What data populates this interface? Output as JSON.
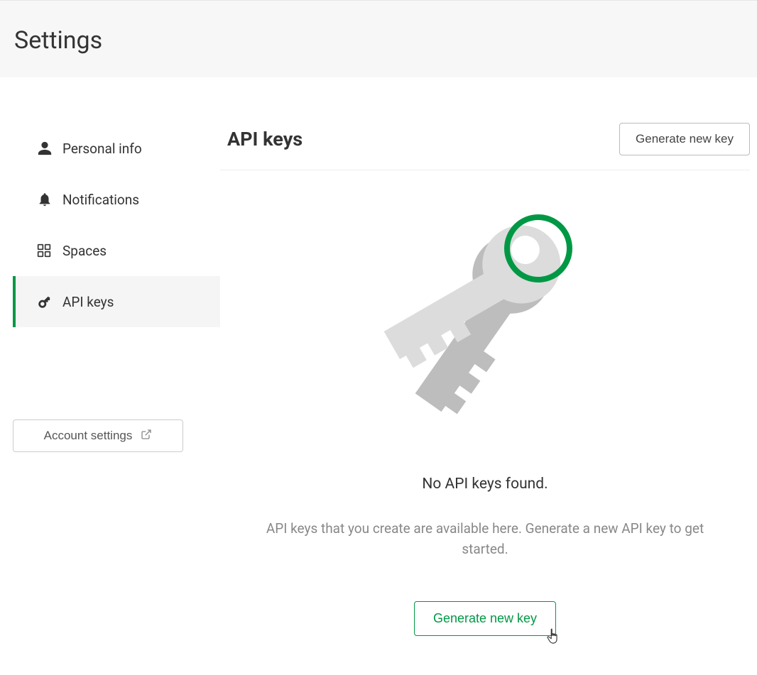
{
  "header": {
    "title": "Settings"
  },
  "sidebar": {
    "items": [
      {
        "label": "Personal info",
        "icon": "user-icon"
      },
      {
        "label": "Notifications",
        "icon": "bell-icon"
      },
      {
        "label": "Spaces",
        "icon": "grid-icon"
      },
      {
        "label": "API keys",
        "icon": "key-icon"
      }
    ],
    "account_settings_label": "Account settings"
  },
  "main": {
    "title": "API keys",
    "generate_button_top": "Generate new key",
    "empty_title": "No API keys found.",
    "empty_description": "API keys that you create are available here. Generate a new API key to get started.",
    "generate_button_main": "Generate new key"
  }
}
